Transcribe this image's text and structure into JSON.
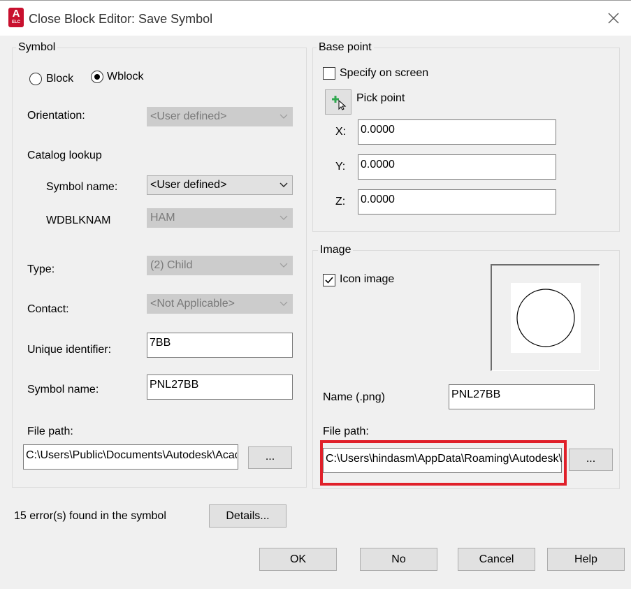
{
  "window": {
    "title": "Close Block Editor: Save Symbol",
    "app_icon_letter": "A",
    "app_icon_sub": "ELC"
  },
  "symbol": {
    "group_title": "Symbol",
    "radio_block": "Block",
    "radio_wblock": "Wblock",
    "radio_selected": "Wblock",
    "orientation_label": "Orientation:",
    "orientation_value": "<User defined>",
    "catalog_lookup_label": "Catalog lookup",
    "symbol_name_combo_label": "Symbol name:",
    "symbol_name_combo_value": "<User defined>",
    "wdblknam_label": "WDBLKNAM",
    "wdblknam_value": "HAM",
    "type_label": "Type:",
    "type_value": "(2) Child",
    "contact_label": "Contact:",
    "contact_value": "<Not Applicable>",
    "unique_id_label": "Unique identifier:",
    "unique_id_value": "7BB",
    "symbol_name_label": "Symbol name:",
    "symbol_name_value": "PNL27BB",
    "file_path_label": "File path:",
    "file_path_value": "C:\\Users\\Public\\Documents\\Autodesk\\Acad",
    "browse_label": "..."
  },
  "base_point": {
    "group_title": "Base point",
    "specify_on_screen": "Specify on screen",
    "specify_checked": false,
    "pick_point": "Pick point",
    "x_label": "X:",
    "x_value": "0.0000",
    "y_label": "Y:",
    "y_value": "0.0000",
    "z_label": "Z:",
    "z_value": "0.0000"
  },
  "image": {
    "group_title": "Image",
    "icon_image": "Icon image",
    "icon_image_checked": true,
    "name_label": "Name (.png)",
    "name_value": "PNL27BB",
    "file_path_label": "File path:",
    "file_path_value": "C:\\Users\\hindasm\\AppData\\Roaming\\Autodesk\\",
    "browse_label": "...",
    "highlight_color": "#e0202a"
  },
  "status": {
    "errors_text": "15 error(s) found in the symbol",
    "details_label": "Details..."
  },
  "buttons": {
    "ok": "OK",
    "no": "No",
    "cancel": "Cancel",
    "help": "Help"
  }
}
